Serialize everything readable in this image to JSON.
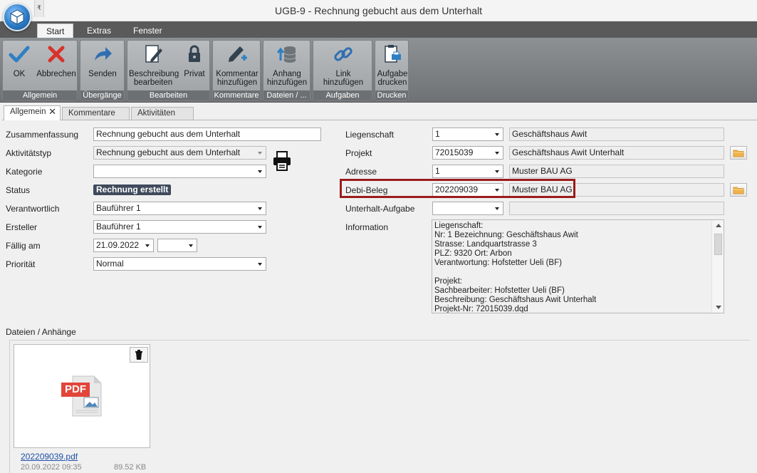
{
  "window": {
    "title": "UGB-9 - Rechnung gebucht aus dem Unterhalt",
    "qat_glyph": "₹"
  },
  "ribbon_tabs": [
    "Start",
    "Extras",
    "Fenster"
  ],
  "ribbon": {
    "groups": [
      {
        "label": "Allgemein",
        "buttons": [
          "OK",
          "Abbrechen"
        ]
      },
      {
        "label": "Übergänge",
        "buttons": [
          "Senden"
        ]
      },
      {
        "label": "Bearbeiten",
        "buttons": [
          "Beschreibung bearbeiten",
          "Privat"
        ]
      },
      {
        "label": "Kommentare",
        "buttons": [
          "Kommentar hinzufügen"
        ]
      },
      {
        "label": "Dateien / ...",
        "buttons": [
          "Anhang hinzufügen"
        ]
      },
      {
        "label": "Aufgaben",
        "buttons": [
          "Link hinzufügen"
        ]
      },
      {
        "label": "Drucken",
        "buttons": [
          "Aufgabe drucken"
        ]
      }
    ],
    "button_lines": {
      "ok": [
        "OK"
      ],
      "abbrechen": [
        "Abbrechen"
      ],
      "senden": [
        "Senden"
      ],
      "beschreibung": [
        "Beschreibung",
        "bearbeiten"
      ],
      "privat": [
        "Privat"
      ],
      "kommentar": [
        "Kommentar",
        "hinzufügen"
      ],
      "anhang": [
        "Anhang",
        "hinzufügen"
      ],
      "link": [
        "Link hinzufügen"
      ],
      "aufgabe": [
        "Aufgabe",
        "drucken"
      ]
    }
  },
  "doc_tabs": [
    "Allgemein",
    "Kommentare",
    "Aktivitäten"
  ],
  "left_form": {
    "zusammenfassung": {
      "label": "Zusammenfassung",
      "value": "Rechnung gebucht aus dem Unterhalt"
    },
    "aktivitaetstyp": {
      "label": "Aktivitätstyp",
      "value": "Rechnung gebucht aus dem Unterhalt"
    },
    "kategorie": {
      "label": "Kategorie",
      "value": ""
    },
    "status": {
      "label": "Status",
      "value": "Rechnung erstellt"
    },
    "verantwortlich": {
      "label": "Verantwortlich",
      "value": "Bauführer 1"
    },
    "ersteller": {
      "label": "Ersteller",
      "value": "Bauführer 1"
    },
    "faellig": {
      "label": "Fällig am",
      "value": "21.09.2022",
      "time": ""
    },
    "prioritaet": {
      "label": "Priorität",
      "value": "Normal"
    }
  },
  "right_form": {
    "liegenschaft": {
      "label": "Liegenschaft",
      "value": "1",
      "detail": "Geschäftshaus Awit"
    },
    "projekt": {
      "label": "Projekt",
      "value": "72015039",
      "detail": "Geschäftshaus Awit Unterhalt"
    },
    "adresse": {
      "label": "Adresse",
      "value": "1",
      "detail": "Muster BAU AG"
    },
    "debi_beleg": {
      "label": "Debi-Beleg",
      "value": "202209039",
      "detail": "Muster BAU AG"
    },
    "unterhalt_aufgabe": {
      "label": "Unterhalt-Aufgabe",
      "value": "",
      "detail": ""
    },
    "information": {
      "label": "Information",
      "lines": [
        "Liegenschaft:",
        "Nr: 1 Bezeichnung: Geschäftshaus Awit",
        "Strasse: Landquartstrasse 3",
        "PLZ: 9320 Ort: Arbon",
        "Verantwortung: Hofstetter Ueli (BF)",
        "",
        "Projekt:",
        "Sachbearbeiter: Hofstetter Ueli (BF)",
        "Beschreibung: Geschäftshaus Awit Unterhalt",
        "Projekt-Nr: 72015039.dqd"
      ]
    }
  },
  "attachments": {
    "label": "Dateien / Anhänge",
    "files": [
      {
        "name": "202209039.pdf",
        "date": "20.09.2022 09:35",
        "size": "89.52 KB",
        "badge": "PDF"
      }
    ]
  },
  "colors": {
    "highlight": "#9b1c1c",
    "status_badge": "#3f4a5c",
    "ok_check": "#2f7fc4",
    "cancel_x": "#d8322a",
    "pdf_red": "#e2453a"
  }
}
